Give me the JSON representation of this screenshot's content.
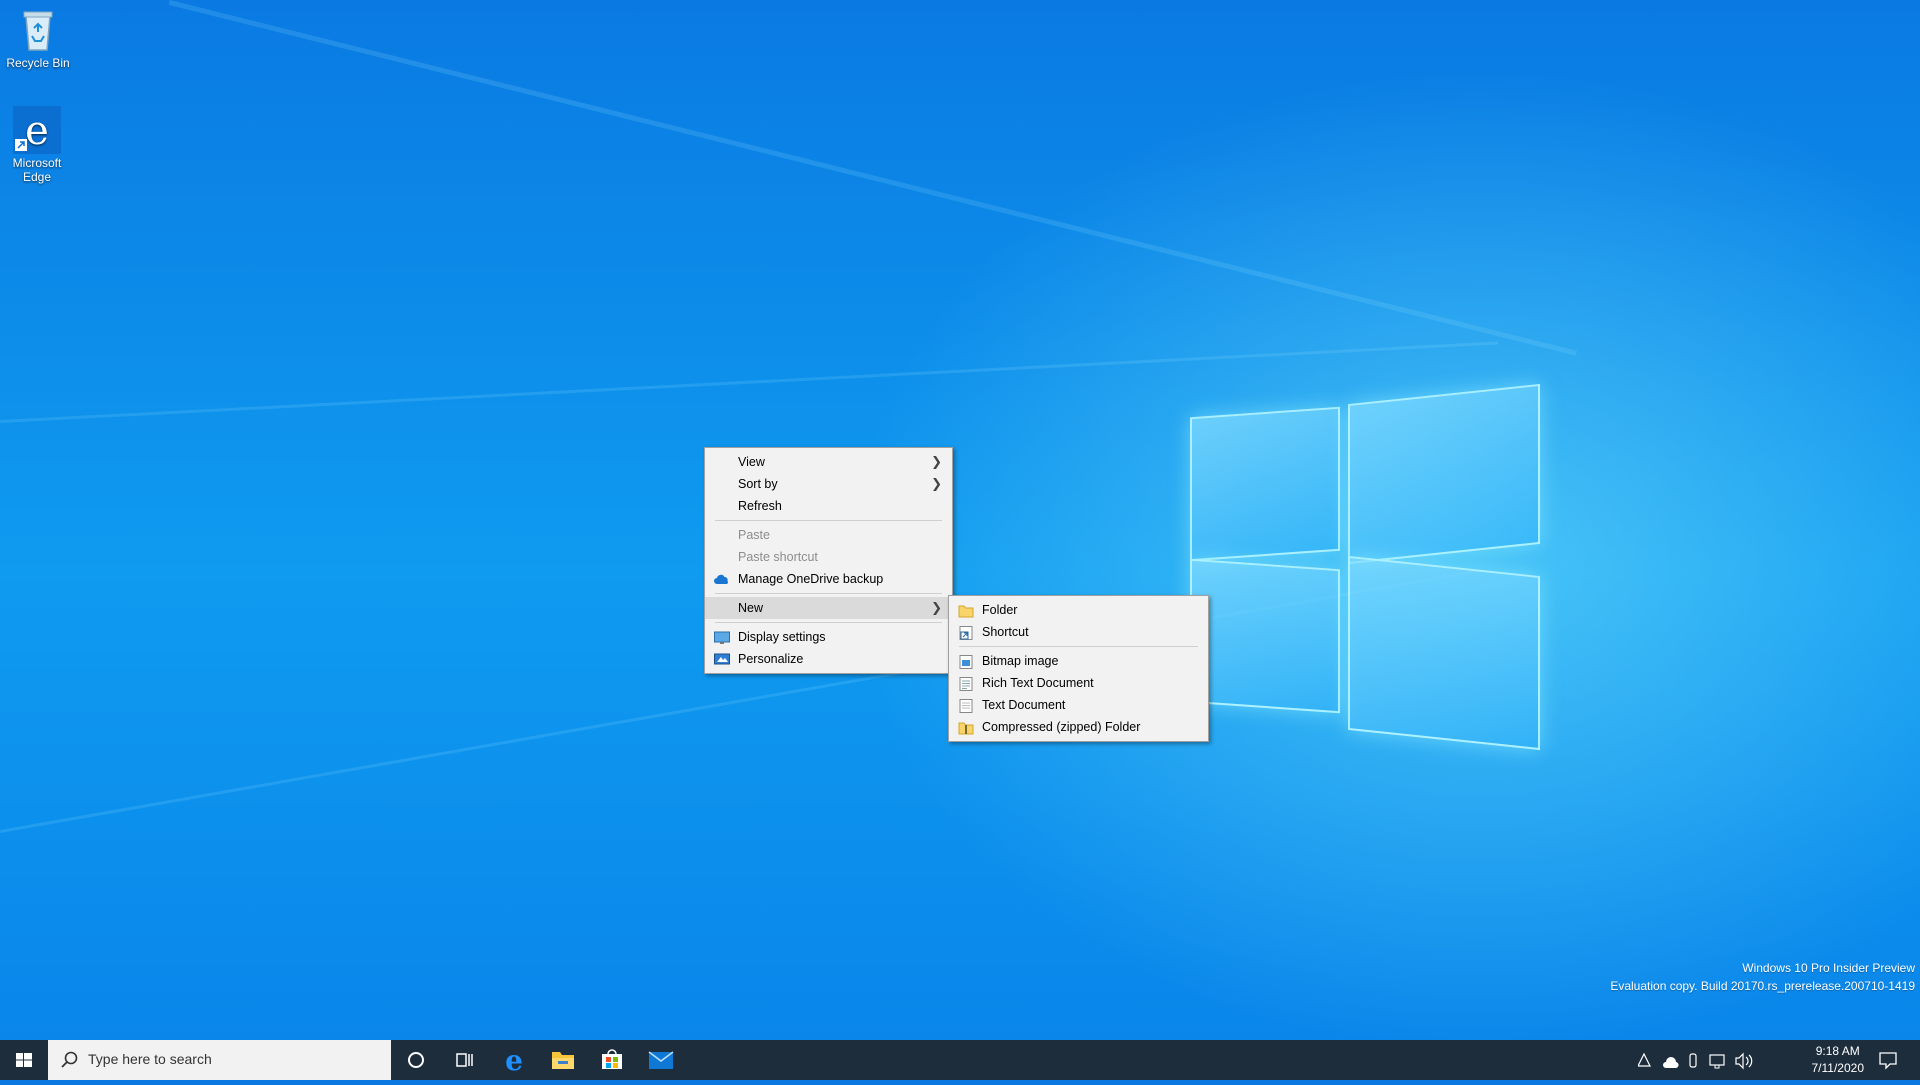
{
  "desktop": {
    "icons": [
      {
        "label": "Recycle Bin",
        "icon": "recycle-bin-icon"
      },
      {
        "label": "Microsoft Edge",
        "icon": "edge-icon"
      }
    ],
    "watermark": {
      "line1": "Windows 10 Pro Insider Preview",
      "line2": "Evaluation copy. Build 20170.rs_prerelease.200710-1419"
    }
  },
  "context_menu": {
    "items": [
      {
        "label": "View",
        "has_submenu": true
      },
      {
        "label": "Sort by",
        "has_submenu": true
      },
      {
        "label": "Refresh"
      },
      {
        "label": "Paste",
        "disabled": true
      },
      {
        "label": "Paste shortcut",
        "disabled": true
      },
      {
        "label": "Manage OneDrive backup",
        "icon": "onedrive-icon"
      },
      {
        "label": "New",
        "has_submenu": true,
        "highlighted": true
      },
      {
        "label": "Display settings",
        "icon": "display-icon"
      },
      {
        "label": "Personalize",
        "icon": "personalize-icon"
      }
    ]
  },
  "new_submenu": {
    "items": [
      {
        "label": "Folder",
        "icon": "folder-icon"
      },
      {
        "label": "Shortcut",
        "icon": "shortcut-icon"
      },
      {
        "label": "Bitmap image",
        "icon": "bitmap-icon"
      },
      {
        "label": "Rich Text Document",
        "icon": "rtf-document-icon"
      },
      {
        "label": "Text Document",
        "icon": "text-document-icon"
      },
      {
        "label": "Compressed (zipped) Folder",
        "icon": "zip-folder-icon"
      }
    ]
  },
  "taskbar": {
    "search_placeholder": "Type here to search",
    "pinned": [
      "cortana-icon",
      "task-view-icon",
      "edge-icon",
      "file-explorer-icon",
      "store-icon",
      "mail-icon"
    ],
    "clock": {
      "time": "9:18 AM",
      "date": "7/11/2020"
    }
  },
  "colors": {
    "menu_bg": "#f2f2f2",
    "menu_hover": "#dadada",
    "taskbar": "#1d2d3c",
    "accent": "#0078d7"
  }
}
